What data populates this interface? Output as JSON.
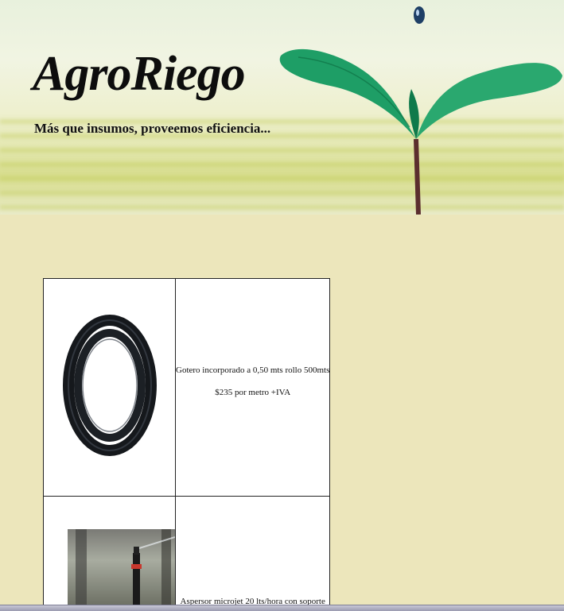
{
  "header": {
    "brand": "AgroRiego",
    "tagline": "Más que insumos, proveemos eficiencia..."
  },
  "products": [
    {
      "description": "Gotero incorporado a 0,50 mts rollo 500mts",
      "price": "$235 por metro +IVA"
    },
    {
      "description": "Aspersor microjet 20 lts/hora con soporte"
    }
  ]
}
